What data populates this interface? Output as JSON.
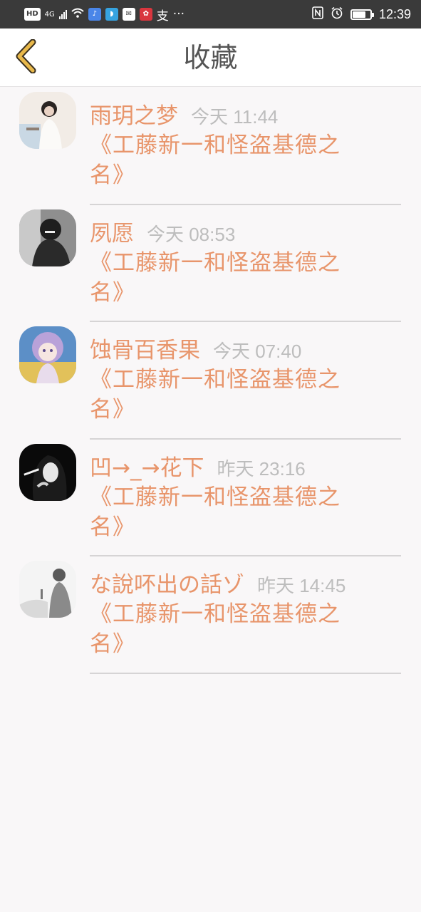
{
  "status_bar": {
    "hd": "HD",
    "network": "4G",
    "app_icons": [
      "music-app-icon",
      "browser-app-icon",
      "huawei-app-icon",
      "red-app-icon"
    ],
    "alipay_glyph": "支",
    "more": "···",
    "time": "12:39",
    "battery_level": 0.75
  },
  "header": {
    "title": "收藏",
    "accent_color": "#e8b84a"
  },
  "favorites": [
    {
      "name": "雨玥之梦",
      "time": "今天 11:44",
      "title": "《工藤新一和怪盗基德之名》"
    },
    {
      "name": "夙愿",
      "time": "今天 08:53",
      "title": "《工藤新一和怪盗基德之名》"
    },
    {
      "name": "蚀骨百香果",
      "time": "今天 07:40",
      "title": "《工藤新一和怪盗基德之名》"
    },
    {
      "name": "凹→_→花下",
      "time": "昨天 23:16",
      "title": "《工藤新一和怪盗基德之名》"
    },
    {
      "name": "な說吥出の話ゾ",
      "time": "昨天 14:45",
      "title": "《工藤新一和怪盗基德之名》"
    }
  ],
  "colors": {
    "name": "#e8956b",
    "time": "#bdbdbd",
    "background": "#f9f7f8"
  }
}
